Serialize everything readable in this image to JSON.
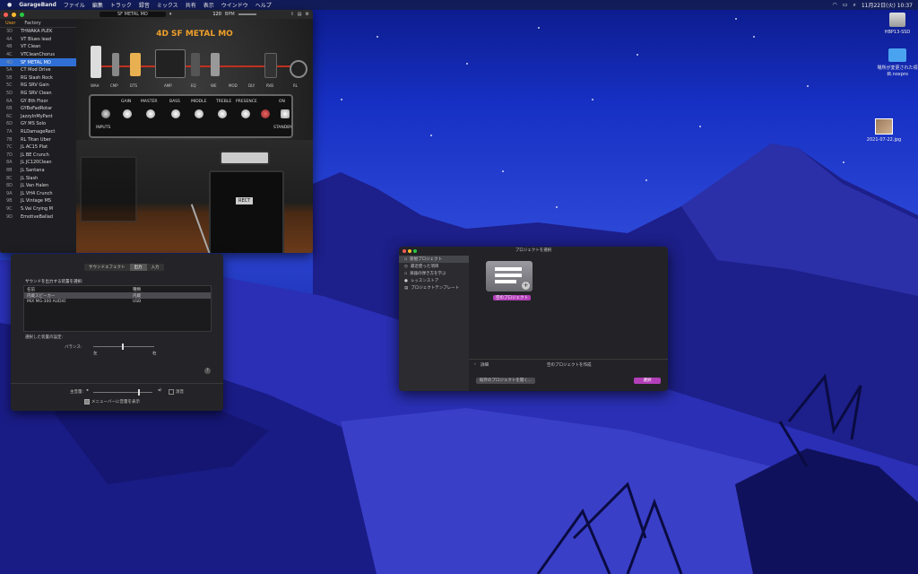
{
  "menubar": {
    "app": "GarageBand",
    "items": [
      "ファイル",
      "編集",
      "トラック",
      "録音",
      "ミックス",
      "共有",
      "表示",
      "ウインドウ",
      "ヘルプ"
    ],
    "clock": "11月22日(火) 10:37"
  },
  "desktop_icons": [
    {
      "label": "HBP13-SSD"
    },
    {
      "label": "場所が変更された項目.noxpro"
    },
    {
      "label": "2021-07-22.jpg"
    }
  ],
  "garageband": {
    "patch_name": "SF METAL MO",
    "tempo": "120",
    "tempo_unit": "BPM",
    "sidebar_tabs": [
      "User",
      "Factory"
    ],
    "presets": [
      {
        "num": "3D",
        "name": "THWAKA PLEK"
      },
      {
        "num": "4A",
        "name": "VT Blues lead"
      },
      {
        "num": "4B",
        "name": "VT Clean"
      },
      {
        "num": "4C",
        "name": "VTCleanChorus"
      },
      {
        "num": "4D",
        "name": "SF METAL MO"
      },
      {
        "num": "5A",
        "name": "CT Mod Drive"
      },
      {
        "num": "5B",
        "name": "RG Slash Rock"
      },
      {
        "num": "5C",
        "name": "RG SRV Gain"
      },
      {
        "num": "5D",
        "name": "RG SRV Clean"
      },
      {
        "num": "6A",
        "name": "GY 8th Floor"
      },
      {
        "num": "6B",
        "name": "GYBoFadRotar"
      },
      {
        "num": "6C",
        "name": "JazzyInMyPant"
      },
      {
        "num": "6D",
        "name": "GY MS Solo"
      },
      {
        "num": "7A",
        "name": "RLDamageRect"
      },
      {
        "num": "7B",
        "name": "RL Titan Uber"
      },
      {
        "num": "7C",
        "name": "JL AC15 Plat"
      },
      {
        "num": "7D",
        "name": "JL BE Crunch"
      },
      {
        "num": "8A",
        "name": "JL JC120Clean"
      },
      {
        "num": "8B",
        "name": "JL Santana"
      },
      {
        "num": "8C",
        "name": "JL Slash"
      },
      {
        "num": "8D",
        "name": "JL Van Halen"
      },
      {
        "num": "9A",
        "name": "JL VH4 Crunch"
      },
      {
        "num": "9B",
        "name": "JL Vintage MS"
      },
      {
        "num": "9C",
        "name": "S.Vai Crying M"
      },
      {
        "num": "9D",
        "name": "EmotiveBallad"
      }
    ],
    "amp_title": "4D SF METAL MO",
    "chain_labels": [
      "WAH",
      "CMP",
      "DTS",
      "AMP",
      "EQ",
      "WE",
      "MOD",
      "DLY",
      "RVB",
      "RL"
    ],
    "knob_labels": [
      "GAIN",
      "MASTER",
      "BASS",
      "MIDDLE",
      "TREBLE",
      "PRESENCE",
      "ON"
    ],
    "inputs_label": "INPUTS",
    "standby_label": "STANDBY",
    "cab_brand": "RECT"
  },
  "audio_settings": {
    "tabs": [
      "サウンドエフェクト",
      "出力",
      "入力"
    ],
    "active_tab": 1,
    "heading": "サウンドを出力する装置を選択:",
    "col_name": "名前",
    "col_type": "種類",
    "devices": [
      {
        "name": "内蔵スピーカー",
        "type": "内蔵"
      },
      {
        "name": "MiX MG-300 AUDIO",
        "type": "USB"
      }
    ],
    "selected_heading": "選択した装置の設定:",
    "balance_label": "バランス:",
    "balance_left": "左",
    "balance_right": "右",
    "volume_label": "主音量:",
    "mute_label": "消音",
    "show_in_menubar": "メニューバーに音量を表示",
    "help": "?"
  },
  "project_chooser": {
    "title": "プロジェクトを選択",
    "sidebar": [
      "新規プロジェクト",
      "最近使った項目",
      "楽器の弾き方を学ぶ",
      "レッスンストア",
      "プロジェクトテンプレート"
    ],
    "selected": 0,
    "tile_label": "空のプロジェクト",
    "details_label": "詳細",
    "details_text": "空のプロジェクトを作成",
    "open_button": "既存のプロジェクトを開く...",
    "choose_button": "選択"
  },
  "colors": {
    "accent": "#2f6fd6",
    "amp_orange": "#f0a02a",
    "choose_purple": "#b33fb8"
  }
}
